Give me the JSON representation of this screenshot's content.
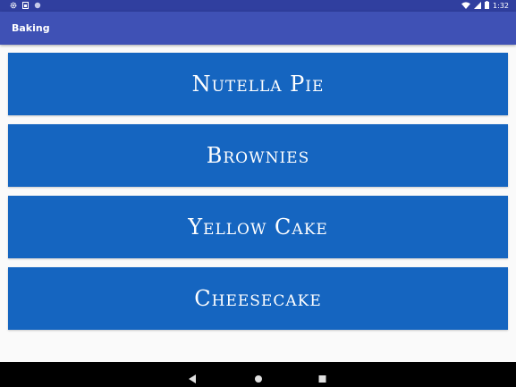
{
  "status_bar": {
    "time": "1:32",
    "icons": [
      "settings-icon",
      "sim-icon",
      "circle-icon",
      "wifi-icon",
      "signal-icon",
      "battery-icon"
    ]
  },
  "app_bar": {
    "title": "Baking"
  },
  "recipes": [
    {
      "name": "Nutella Pie"
    },
    {
      "name": "Brownies"
    },
    {
      "name": "Yellow Cake"
    },
    {
      "name": "Cheesecake"
    }
  ],
  "colors": {
    "status_bar": "#303f9f",
    "app_bar": "#3f51b5",
    "card": "#1565c0",
    "background": "#fafafa"
  },
  "nav_bar": {
    "icons": [
      "back-icon",
      "home-icon",
      "recents-icon"
    ]
  }
}
